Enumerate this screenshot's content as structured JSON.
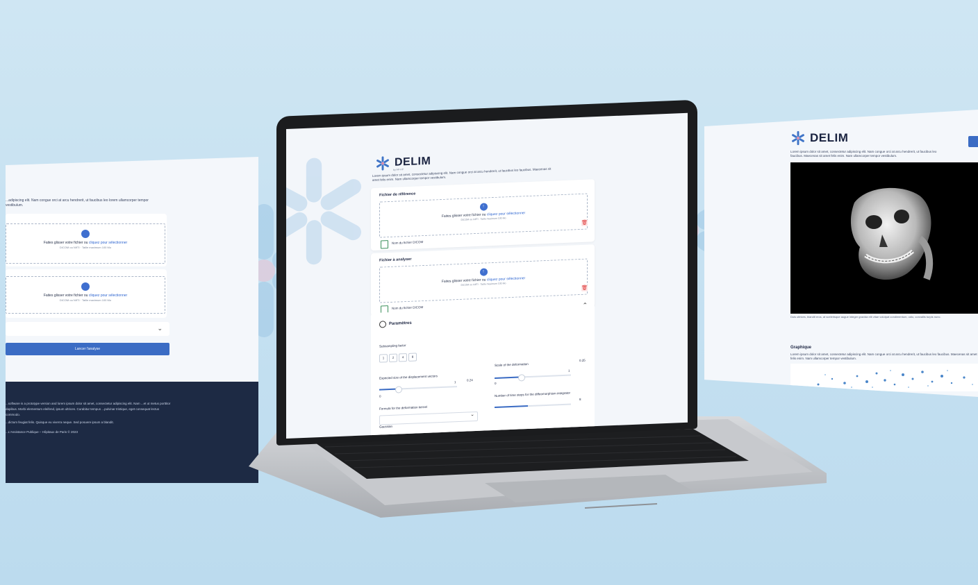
{
  "brand": {
    "name": "DELIM",
    "accent": "#3b6cc4",
    "snowflake_color": "#3f74c7"
  },
  "left_panel": {
    "intro": "...adipiscing elit. Nam congue orci at arcu hendrerit, ut faucibus leo lorem ullamcorper tempor vestibulum.",
    "drop_text": "Faites glisser votre fichier ou",
    "drop_link": "cliquez pour sélectionner",
    "drop_sub": "DICOM ou NIfTI · Taille maximum 100 Mo",
    "run_button": "Lancer l'analyse",
    "footer": [
      "...software is a prototype version and lorem ipsum dolor sit amet, consectetur adipiscing elit. Nam ...et ut metus porttitor dapibus. Morbi elementum eleifend, ipsum ultrices. Curabitur tempus ...pulvinar tristique, eget consequat lectus commodo.",
      "...dictum feugiat felis. Quisque eu viverra neque. Sed posuere ipsum a blandit.",
      "...L'Assistance Publique – Hôpitaux de Paris © 2023"
    ]
  },
  "main_screen": {
    "logo_sub": "by AP-HP",
    "description": "Lorem ipsum dolor sit amet, consectetur adipiscing elit. Nam congue orci at arcu hendrerit, ut faucibus leo faucibus. Maecenas sit amet felis enim. Nam ullamcorper tempor vestibulum.",
    "reference_card": {
      "title": "Fichier de référence",
      "drop_text": "Faites glisser votre fichier ou",
      "drop_link": "cliquez pour sélectionner",
      "drop_sub": "DICOM ou NIfTI · Taille maximum 100 Mo",
      "file_name": "Nom du fichier DICOM"
    },
    "analyze_card": {
      "title": "Fichier à analyser",
      "drop_text": "Faites glisser votre fichier ou",
      "drop_link": "cliquez pour sélectionner",
      "drop_sub": "DICOM ou NIfTI · Taille maximum 100 Mo",
      "file_name": "Nom du fichier DICOM"
    },
    "params": {
      "title": "Paramètres",
      "subsampling_label": "Subsampling factor",
      "subsampling_options": [
        "1",
        "2",
        "4",
        "8"
      ],
      "disp_label": "Expected size of the displacement vectors",
      "disp_min": "0",
      "disp_value": "0.24",
      "disp_max": "1",
      "scale_label": "Scale of the deformation",
      "scale_min": "0",
      "scale_value": "0.35",
      "scale_max": "1",
      "kernel_label": "Formula for the deformation kernel",
      "kernel_selected": "Gaussian",
      "steps_label": "Number of time steps for the diffeomorphism integrator",
      "steps_value": "8"
    }
  },
  "right_panel": {
    "description": "Lorem ipsum dolor sit amet, consectetur adipiscing elit. Nam congue orci at arcu hendrerit, ut faucibus leo faucibus. Maecenas sit amet felis enim. Nam ullamcorper tempor vestibulum.",
    "caption": "Duis ultrices, blandit eros, at scelerisque augue integer gravida elit vitae volutpat condimentum, odio, convallis turpis nunc.",
    "graph_title": "Graphique",
    "graph_desc": "Lorem ipsum dolor sit amet, consectetur adipiscing elit. Nam congue orci at arcu hendrerit, ut faucibus leo faucibus. Maecenas sit amet felis enim. Nam ullamcorper tempor vestibulum."
  }
}
